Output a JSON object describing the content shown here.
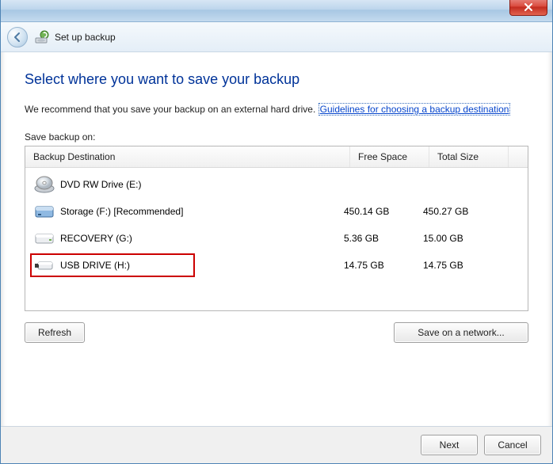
{
  "window": {
    "title": "Set up backup"
  },
  "heading": "Select where you want to save your backup",
  "recommend_text": "We recommend that you save your backup on an external hard drive. ",
  "guidelines_link": "Guidelines for choosing a backup destination",
  "save_label": "Save backup on:",
  "columns": {
    "destination": "Backup Destination",
    "free": "Free Space",
    "size": "Total Size"
  },
  "drives": [
    {
      "name": "DVD RW Drive (E:)",
      "free": "",
      "size": "",
      "icon": "dvd"
    },
    {
      "name": "Storage (F:) [Recommended]",
      "free": "450.14 GB",
      "size": "450.27 GB",
      "icon": "hdd"
    },
    {
      "name": "RECOVERY (G:)",
      "free": "5.36 GB",
      "size": "15.00 GB",
      "icon": "ext"
    },
    {
      "name": "USB DRIVE (H:)",
      "free": "14.75 GB",
      "size": "14.75 GB",
      "icon": "usb",
      "highlight": true
    }
  ],
  "buttons": {
    "refresh": "Refresh",
    "save_network": "Save on a network...",
    "next": "Next",
    "cancel": "Cancel"
  }
}
